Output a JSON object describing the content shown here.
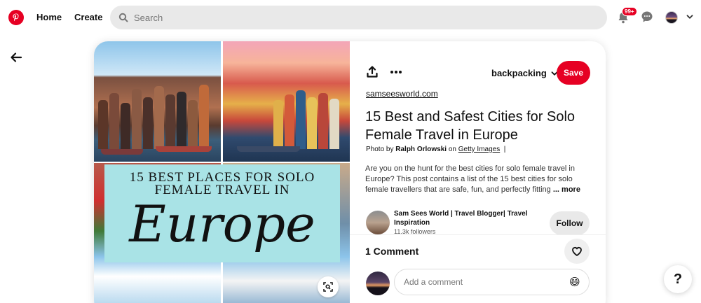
{
  "nav": {
    "home_label": "Home",
    "create_label": "Create",
    "search_placeholder": "Search",
    "notifications_badge": "99+",
    "icons": [
      "pinterest-logo-icon",
      "search-icon",
      "bell-icon",
      "chat-icon",
      "chevron-down-icon"
    ]
  },
  "pin": {
    "image_text": {
      "headline": "15 BEST PLACES FOR SOLO FEMALE TRAVEL IN",
      "script": "Europe"
    },
    "board_name": "backpacking",
    "save_label": "Save",
    "source_link": "samseesworld.com",
    "title": "15 Best and Safest Cities for Solo Female Travel in Europe",
    "credit": {
      "prefix": "Photo by",
      "author": "Ralph Orlowski",
      "on": "on",
      "agency": "Getty Images",
      "separator": "|"
    },
    "description": "Are you on the hunt for the best cities for solo female travel in Europe? This post contains a list of the 15 best cities for solo female travellers that are safe, fun, and perfectly fitting",
    "more_label": "... more",
    "creator": {
      "name": "Sam Sees World | Travel Blogger| Travel Inspiration",
      "followers": "11.3k followers"
    },
    "follow_label": "Follow",
    "comments_heading": "1 Comment",
    "comment_placeholder": "Add a comment",
    "emoji": "😄"
  },
  "help_label": "?",
  "colors": {
    "brand_red": "#e60023",
    "search_bg": "#e9e9e9",
    "overlay_teal": "#a9e3e6"
  }
}
